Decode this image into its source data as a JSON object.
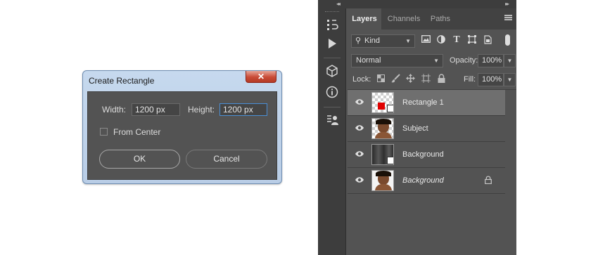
{
  "dialog": {
    "title": "Create Rectangle",
    "close_label": "✕",
    "width_label": "Width:",
    "width_value": "1200 px",
    "height_label": "Height:",
    "height_value": "1200 px",
    "from_center_label": "From Center",
    "from_center_checked": false,
    "ok_label": "OK",
    "cancel_label": "Cancel"
  },
  "panel": {
    "collapse_left_arrows": "◂◂",
    "collapse_right_arrows": "▸▸",
    "tabs": [
      {
        "label": "Layers",
        "active": true
      },
      {
        "label": "Channels",
        "active": false
      },
      {
        "label": "Paths",
        "active": false
      }
    ],
    "filter": {
      "kind_label": "Kind"
    },
    "blend_mode": "Normal",
    "opacity_label": "Opacity:",
    "opacity_value": "100%",
    "lock_label": "Lock:",
    "fill_label": "Fill:",
    "fill_value": "100%",
    "layers": [
      {
        "name": "Rectangle 1",
        "selected": true,
        "type": "shape"
      },
      {
        "name": "Subject",
        "selected": false,
        "type": "subject"
      },
      {
        "name": "Background",
        "selected": false,
        "type": "smart"
      },
      {
        "name": "Background",
        "selected": false,
        "type": "background",
        "locked": true
      }
    ]
  },
  "colors": {
    "panel_bg": "#535353",
    "selected_row": "#6f6f6f",
    "shape_fill": "#e00000",
    "focus_border": "#4a8fd6"
  }
}
